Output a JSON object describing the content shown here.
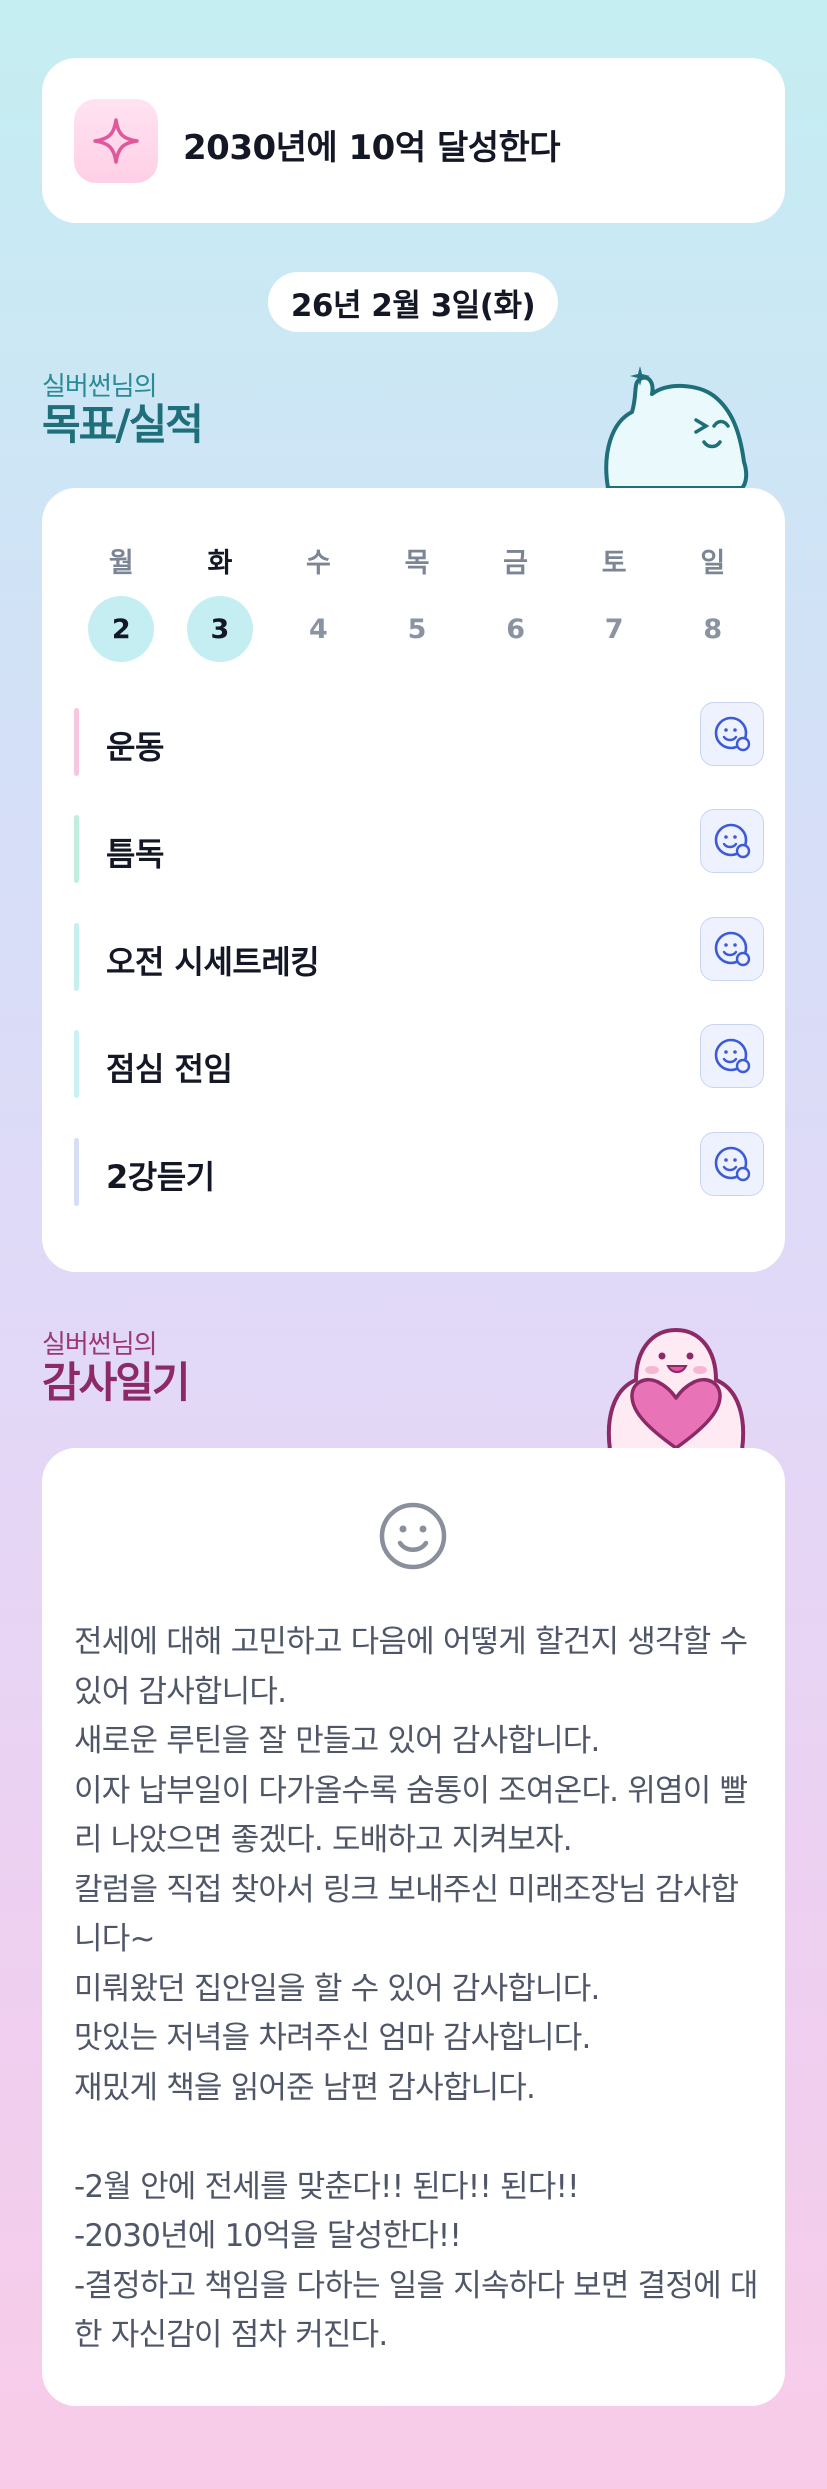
{
  "goal": {
    "text": "2030년에 10억 달성한다",
    "icon": "sparkle-icon"
  },
  "date": {
    "label": "26년 2월 3일(화)"
  },
  "goals_section": {
    "small": "실버썬님의",
    "big": "목표/실적",
    "mascot": "ghost-waving-mascot"
  },
  "week": {
    "days": [
      {
        "name": "월",
        "num": "2",
        "done": true
      },
      {
        "name": "화",
        "num": "3",
        "done": true,
        "active": true
      },
      {
        "name": "수",
        "num": "4"
      },
      {
        "name": "목",
        "num": "5"
      },
      {
        "name": "금",
        "num": "6"
      },
      {
        "name": "토",
        "num": "7"
      },
      {
        "name": "일",
        "num": "8"
      }
    ]
  },
  "tasks": [
    {
      "label": "운동",
      "color": "#f7c6df"
    },
    {
      "label": "틈독",
      "color": "#bfeee0"
    },
    {
      "label": "오전 시세트레킹",
      "color": "#c6f0ee"
    },
    {
      "label": "점심 전임",
      "color": "#c9f1f3"
    },
    {
      "label": "2강듣기",
      "color": "#d6ddf5"
    }
  ],
  "diary_section": {
    "small": "실버썬님의",
    "big": "감사일기",
    "mascot": "ghost-heart-mascot"
  },
  "diary": {
    "mood_icon": "smiley-icon",
    "text": "전세에 대해 고민하고 다음에 어떻게 할건지 생각할 수 있어 감사합니다.\n새로운 루틴을 잘 만들고 있어 감사합니다.\n이자 납부일이 다가올수록 숨통이 조여온다. 위염이 빨리 나았으면 좋겠다. 도배하고 지켜보자.\n칼럼을 직접 찾아서 링크 보내주신 미래조장님 감사합니다~\n미뤄왔던 집안일을 할 수 있어 감사합니다.\n맛있는 저녁을 차려주신 엄마 감사합니다.\n재밌게 책을 읽어준 남편 감사합니다.\n\n-2월 안에 전세를 맞춘다!! 된다!! 된다!!\n-2030년에 10억을 달성한다!!\n-결정하고 책임을 다하는 일을 지속하다 보면 결정에 대한 자신감이 점차 커진다."
  }
}
